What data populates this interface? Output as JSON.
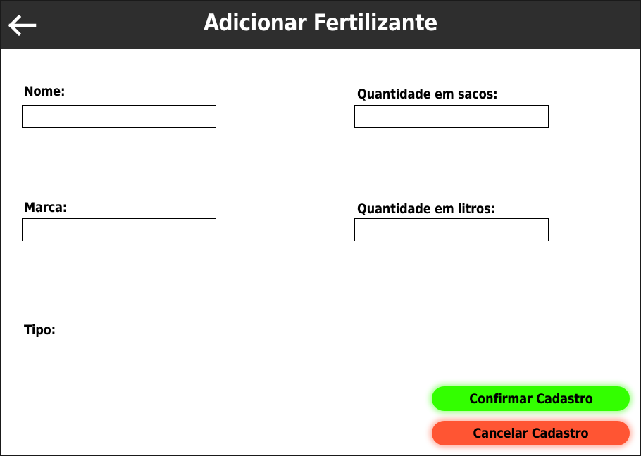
{
  "header": {
    "title": "Adicionar Fertilizante",
    "back_icon": "arrow-left-icon"
  },
  "form": {
    "nome_label": "Nome:",
    "nome_value": "",
    "marca_label": "Marca:",
    "marca_value": "",
    "tipo_label": "Tipo:",
    "qtd_sacos_label": "Quantidade em sacos:",
    "qtd_sacos_value": "",
    "qtd_litros_label": "Quantidade em litros:",
    "qtd_litros_value": ""
  },
  "actions": {
    "confirm_label": "Confirmar Cadastro",
    "cancel_label": "Cancelar Cadastro"
  },
  "colors": {
    "header_bg": "#2e2e2e",
    "confirm_bg": "#33ff00",
    "cancel_bg": "#ff5533"
  }
}
